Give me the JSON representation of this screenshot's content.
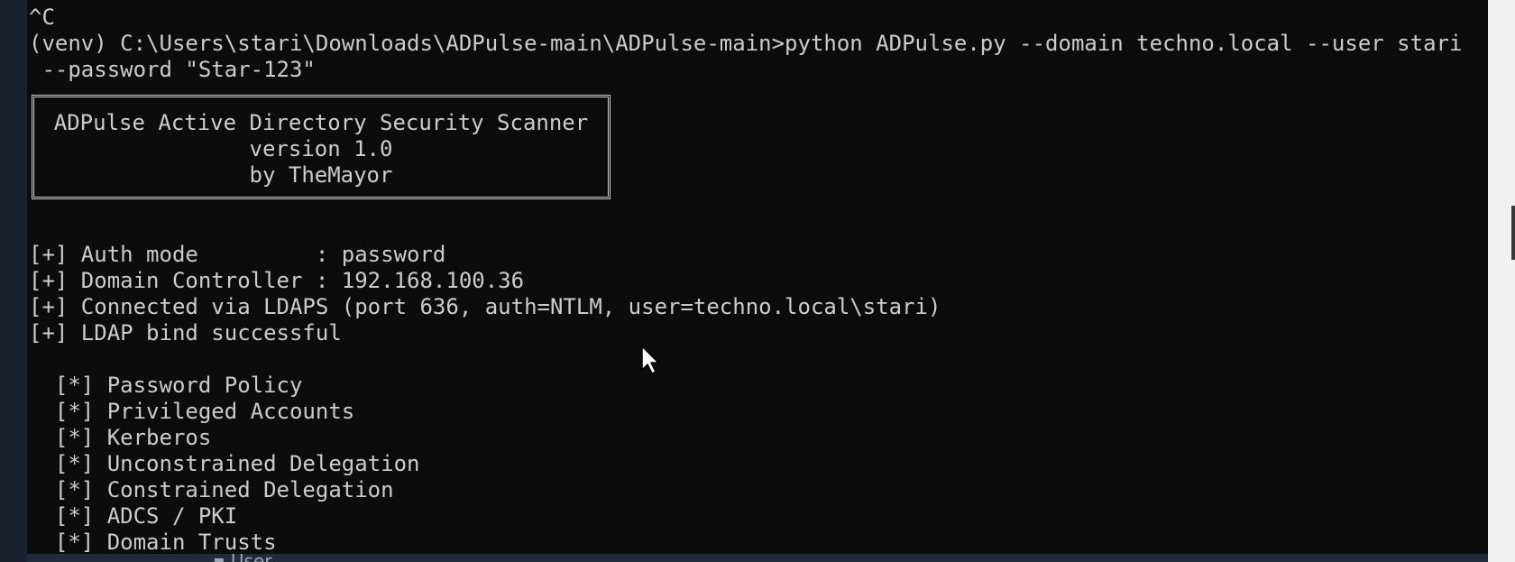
{
  "terminal": {
    "prompt_lines": {
      "interrupt": "^C",
      "command_1": "(venv) C:\\Users\\stari\\Downloads\\ADPulse-main\\ADPulse-main>python ADPulse.py --domain techno.local --user stari",
      "command_2": " --password \"Star-123\""
    },
    "banner": {
      "title": "ADPulse Active Directory Security Scanner",
      "version": "version 1.0",
      "author": "by TheMayor"
    },
    "status_lines": [
      "[+] Auth mode         : password",
      "[+] Domain Controller : 192.168.100.36",
      "[+] Connected via LDAPS (port 636, auth=NTLM, user=techno.local\\stari)",
      "[+] LDAP bind successful"
    ],
    "check_items": [
      "  [*] Password Policy",
      "  [*] Privileged Accounts",
      "  [*] Kerberos",
      "  [*] Unconstrained Delegation",
      "  [*] Constrained Delegation",
      "  [*] ADCS / PKI",
      "  [*] Domain Trusts"
    ]
  },
  "background_window": {
    "partial_text": "▪ User"
  },
  "colors": {
    "terminal_bg": "#0c0c0c",
    "terminal_fg": "#cccccc"
  }
}
